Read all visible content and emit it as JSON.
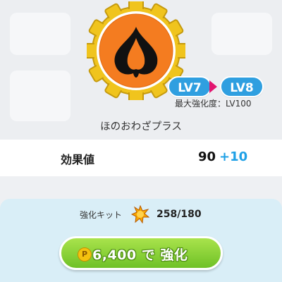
{
  "upgrade": {
    "current_level": "LV7",
    "next_level": "LV8",
    "max_level_text": "最大強化度：LV100",
    "skill_name": "ほのおわざプラス"
  },
  "effect": {
    "label": "効果値",
    "value": "90",
    "bonus": "+10"
  },
  "kit": {
    "label": "強化キット",
    "count": "258/180"
  },
  "button": {
    "coin_symbol": "P",
    "label": "6,400 で 強化"
  },
  "colors": {
    "level_pill": "#2f9fe0",
    "arrow": "#e2156f",
    "bonus": "#1ea0e6",
    "button": "#7cc72f",
    "emblem_orange": "#f47c20",
    "gear_gold": "#f0c41d"
  },
  "icons": {
    "emblem": "fire-type-gear-emblem",
    "kit": "upgrade-kit-star-icon",
    "coin": "poke-coin-icon"
  }
}
